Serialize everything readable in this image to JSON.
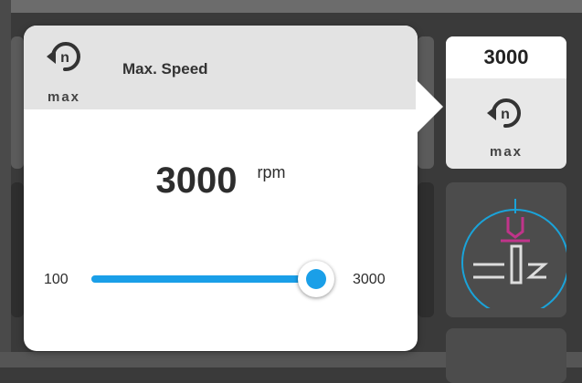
{
  "popup": {
    "title": "Max. Speed",
    "icon_name": "max-speed-icon",
    "icon_label": "max",
    "value": "3000",
    "unit": "rpm",
    "slider": {
      "min_label": "100",
      "max_label": "3000",
      "min": 100,
      "max": 3000,
      "value": 3000
    }
  },
  "speed_tile": {
    "value": "3000",
    "icon_name": "max-speed-icon",
    "icon_label": "max"
  },
  "needle_tile": {
    "icon_name": "needle-position-icon"
  },
  "colors": {
    "accent": "#1a9fe8",
    "needle_accent": "#c0348a",
    "ring": "#1aa3d9"
  }
}
